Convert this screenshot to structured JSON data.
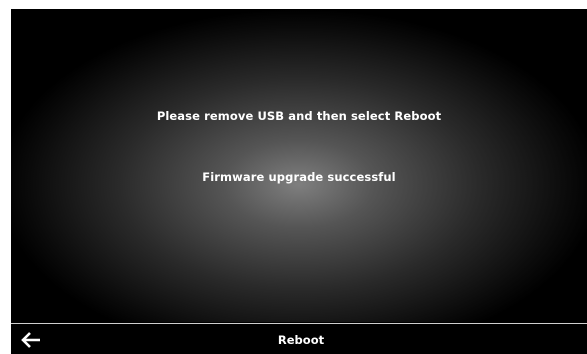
{
  "messages": {
    "instruction": "Please remove USB and then select Reboot",
    "status": "Firmware upgrade successful"
  },
  "bottom_bar": {
    "back_icon": "arrow-left-icon",
    "reboot_label": "Reboot"
  },
  "colors": {
    "screen_background": "#000000",
    "text": "#ffffff",
    "bar_divider": "#cfcfcf"
  }
}
